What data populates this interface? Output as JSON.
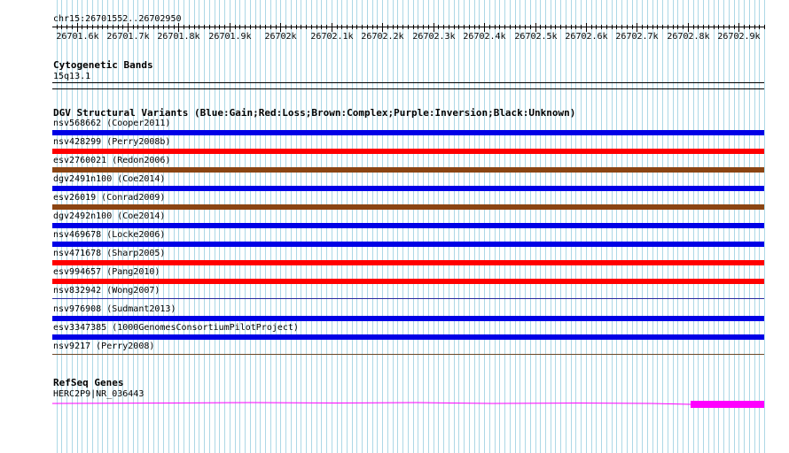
{
  "ruler": {
    "location": "chr15:26701552..26702950",
    "start": 26701552,
    "end": 26702950,
    "ticks": [
      {
        "pos": 26701600,
        "label": "26701.6k"
      },
      {
        "pos": 26701700,
        "label": "26701.7k"
      },
      {
        "pos": 26701800,
        "label": "26701.8k"
      },
      {
        "pos": 26701900,
        "label": "26701.9k"
      },
      {
        "pos": 26702000,
        "label": "26702k"
      },
      {
        "pos": 26702100,
        "label": "26702.1k"
      },
      {
        "pos": 26702200,
        "label": "26702.2k"
      },
      {
        "pos": 26702300,
        "label": "26702.3k"
      },
      {
        "pos": 26702400,
        "label": "26702.4k"
      },
      {
        "pos": 26702500,
        "label": "26702.5k"
      },
      {
        "pos": 26702600,
        "label": "26702.6k"
      },
      {
        "pos": 26702700,
        "label": "26702.7k"
      },
      {
        "pos": 26702800,
        "label": "26702.8k"
      },
      {
        "pos": 26702900,
        "label": "26702.9k"
      }
    ]
  },
  "cytoband_track": {
    "title": "Cytogenetic Bands",
    "band": "15q13.1"
  },
  "dgv_track": {
    "title": "DGV Structural Variants (Blue:Gain;Red:Loss;Brown:Complex;Purple:Inversion;Black:Unknown)",
    "variants": [
      {
        "label": "nsv568662 (Cooper2011)",
        "type": "Gain",
        "color": "#0000e6"
      },
      {
        "label": "nsv428299 (Perry2008b)",
        "type": "Loss",
        "color": "#ff0000"
      },
      {
        "label": "esv2760021 (Redon2006)",
        "type": "Complex",
        "color": "#8b4513"
      },
      {
        "label": "dgv2491n100 (Coe2014)",
        "type": "Gain",
        "color": "#0000e6"
      },
      {
        "label": "esv26019 (Conrad2009)",
        "type": "Complex",
        "color": "#8b4513"
      },
      {
        "label": "dgv2492n100 (Coe2014)",
        "type": "Gain",
        "color": "#0000e6"
      },
      {
        "label": "nsv469678 (Locke2006)",
        "type": "Gain",
        "color": "#0000e6"
      },
      {
        "label": "nsv471678 (Sharp2005)",
        "type": "Loss",
        "color": "#ff0000"
      },
      {
        "label": "esv994657 (Pang2010)",
        "type": "Loss",
        "color": "#ff0000"
      },
      {
        "label": "nsv832942 (Wong2007)",
        "type": "Unknown",
        "color": null
      },
      {
        "label": "nsv976908 (Sudmant2013)",
        "type": "Gain",
        "color": "#0000e6"
      },
      {
        "label": "esv3347385 (1000GenomesConsortiumPilotProject)",
        "type": "Gain",
        "color": "#0000e6"
      },
      {
        "label": "nsv9217 (Perry2008)",
        "type": "Unknown",
        "color": null
      }
    ]
  },
  "refseq_track": {
    "title": "RefSeq Genes",
    "gene_label": "HERC2P9|NR_036443",
    "color": "#ff00ff"
  },
  "colors": {
    "grid": "#add8e6",
    "gain": "#0000e6",
    "loss": "#ff0000",
    "complex": "#8b4513",
    "gene": "#ff00ff"
  }
}
